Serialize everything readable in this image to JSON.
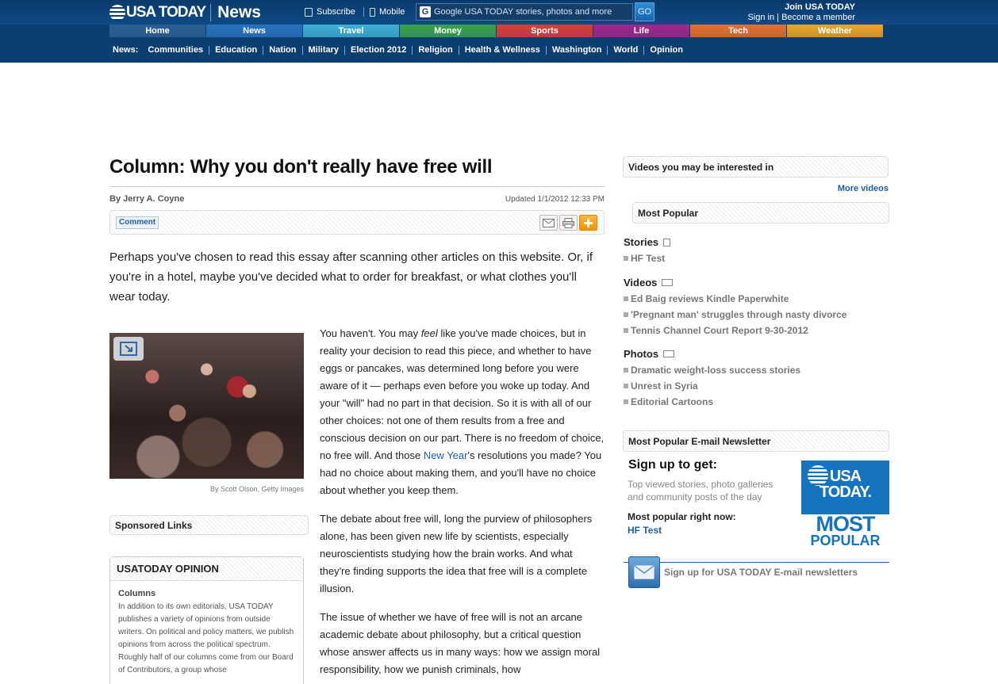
{
  "header": {
    "logo_text": "USA TODAY",
    "section": "News",
    "subscribe": "Subscribe",
    "mobile": "Mobile",
    "search_placeholder": "Google USA TODAY stories, photos and more",
    "go": "GO",
    "join": "Join USA TODAY",
    "sign_in": "Sign in",
    "account_sep": " | ",
    "become_member": "Become a member"
  },
  "main_nav": [
    {
      "label": "Home",
      "color": "#2d5f92"
    },
    {
      "label": "News",
      "color": "#2a72bd"
    },
    {
      "label": "Travel",
      "color": "#3fb0d5"
    },
    {
      "label": "Money",
      "color": "#3aa34a"
    },
    {
      "label": "Sports",
      "color": "#e23b37"
    },
    {
      "label": "Life",
      "color": "#a3268b"
    },
    {
      "label": "Tech",
      "color": "#ef6e25"
    },
    {
      "label": "Weather",
      "color": "#f4a51d"
    }
  ],
  "sub_nav": {
    "label": "News:",
    "items": [
      "Communities",
      "Education",
      "Nation",
      "Military",
      "Election 2012",
      "Religion",
      "Health & Wellness",
      "Washington",
      "World",
      "Opinion"
    ]
  },
  "article": {
    "headline": "Column: Why you don't really have free will",
    "byline": "By Jerry A. Coyne",
    "updated": "Updated 1/1/2012 12:33 PM",
    "comment": "Comment",
    "lead": "Perhaps you've chosen to read this essay after scanning other articles on this website. Or, if you're in a hotel, maybe you've decided what to order for breakfast, or what clothes you'll wear today.",
    "photo_credit": "By Scott Olson, Getty Images",
    "p1_a": "You haven't. You may ",
    "p1_em": "feel",
    "p1_b": " like you've made choices, but in reality your decision to read this piece, and whether to have eggs or pancakes, was determined long before you were aware of it — perhaps even before you woke up today. And your \"will\" had no part in that decision. So it is with all of our other choices: not one of them results from a free and conscious decision on our part. There is no freedom of choice, no free will. And those ",
    "p1_link": "New Year",
    "p1_c": "'s resolutions you made? You had no choice about making them, and you'll have no choice about whether you keep them.",
    "p2": "The debate about free will, long the purview of philosophers alone, has been given new life by scientists, especially neuroscientists studying how the brain works. And what they're finding supports the idea that free will is a complete illusion.",
    "p3": "The issue of whether we have of free will is not an arcane academic debate about philosophy, but a critical question whose answer affects us in many ways: how we assign moral responsibility, how we punish criminals, how"
  },
  "sponsored_links": "Sponsored Links",
  "opinion": {
    "title": "USATODAY OPINION",
    "sub": "Columns",
    "text1": "In addition to its own editorials, USA TODAY publishes a variety of opinions from outside writers. On political and policy matters, we publish opinions from across the political spectrum.",
    "text2": "Roughly half of our columns come from our Board of Contributors, a group whose"
  },
  "sidebar": {
    "videos_interest": "Videos you may be interested in",
    "more_videos": "More videos",
    "most_popular": "Most Popular",
    "stories_label": "Stories",
    "stories": [
      "HF Test"
    ],
    "videos_label": "Videos",
    "videos": [
      "Ed Baig reviews Kindle Paperwhite",
      "'Pregnant man' struggles through nasty divorce",
      "Tennis Channel Court Report 9-30-2012"
    ],
    "photos_label": "Photos",
    "photos": [
      "Dramatic weight-loss success stories",
      "Unrest in Syria",
      "Editorial Cartoons"
    ],
    "newsletter_title": "Most Popular E-mail Newsletter",
    "signup_title": "Sign up to get:",
    "signup_desc": "Top viewed stories, photo galleries and community posts of the day",
    "mp_now": "Most popular right now:",
    "mp_link": "HF Test",
    "badge_line1": "USA",
    "badge_line2": "TODAY.",
    "badge_line3": "MOST",
    "badge_line4": "POPULAR",
    "signup_link": "Sign up for USA TODAY E-mail newsletters"
  }
}
